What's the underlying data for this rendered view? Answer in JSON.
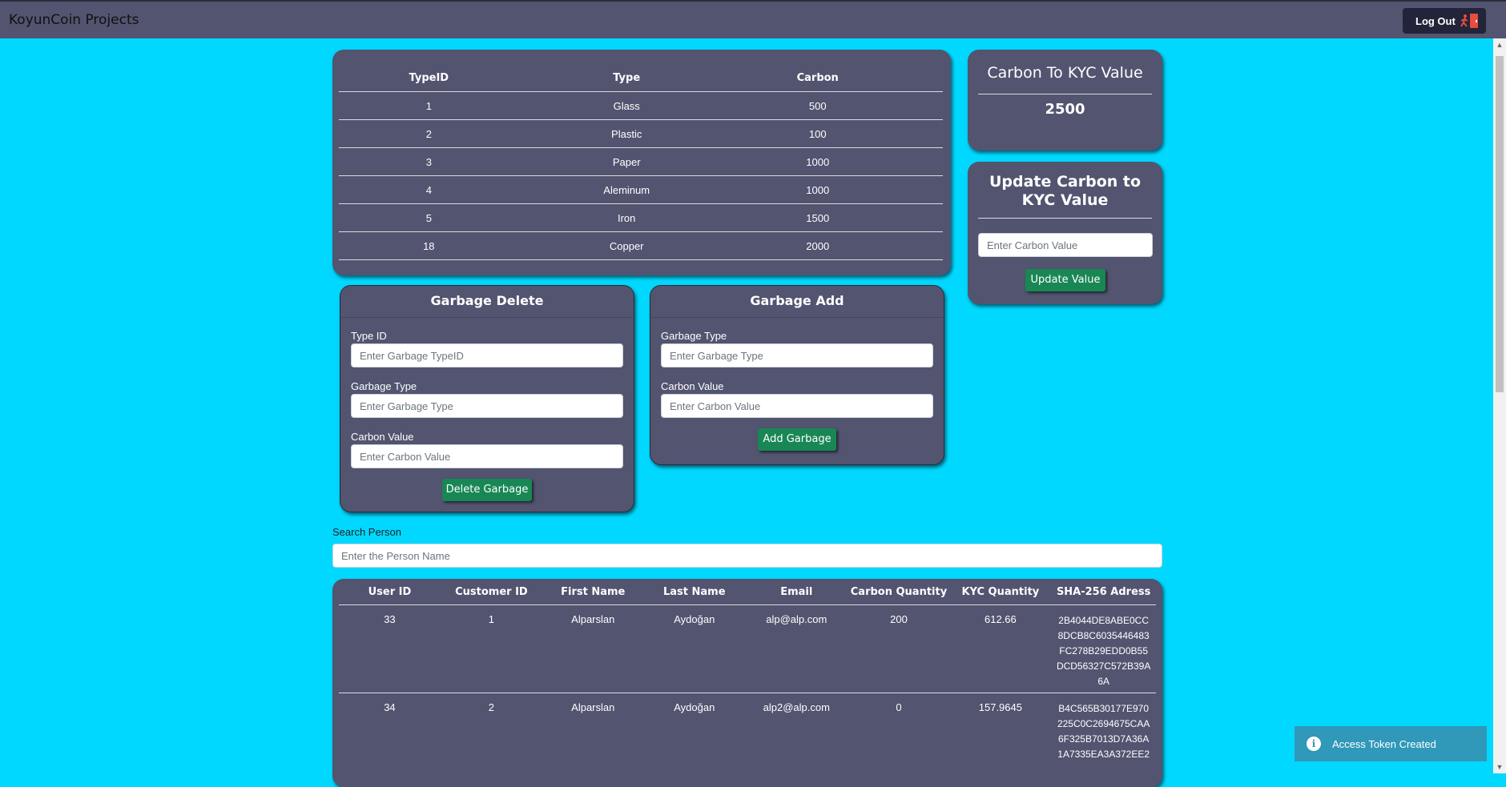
{
  "navbar": {
    "brand": "KoyunCoin Projects",
    "logout_label": "Log Out"
  },
  "garbage_types": {
    "headers": [
      "TypeID",
      "Type",
      "Carbon"
    ],
    "rows": [
      [
        "1",
        "Glass",
        "500"
      ],
      [
        "2",
        "Plastic",
        "100"
      ],
      [
        "3",
        "Paper",
        "1000"
      ],
      [
        "4",
        "Aleminum",
        "1000"
      ],
      [
        "5",
        "Iron",
        "1500"
      ],
      [
        "18",
        "Copper",
        "2000"
      ]
    ]
  },
  "kyc_card": {
    "title": "Carbon To KYC Value",
    "value": "2500"
  },
  "update_card": {
    "title": "Update Carbon to KYC Value",
    "placeholder": "Enter Carbon Value",
    "button": "Update Value"
  },
  "delete_card": {
    "title": "Garbage Delete",
    "type_id_label": "Type ID",
    "type_id_placeholder": "Enter Garbage TypeID",
    "type_label": "Garbage Type",
    "type_placeholder": "Enter Garbage Type",
    "carbon_label": "Carbon Value",
    "carbon_placeholder": "Enter Carbon Value",
    "button": "Delete Garbage"
  },
  "add_card": {
    "title": "Garbage Add",
    "type_label": "Garbage Type",
    "type_placeholder": "Enter Garbage Type",
    "carbon_label": "Carbon Value",
    "carbon_placeholder": "Enter Carbon Value",
    "button": "Add Garbage"
  },
  "search": {
    "label": "Search Person",
    "placeholder": "Enter the Person Name"
  },
  "users": {
    "headers": [
      "User ID",
      "Customer ID",
      "First Name",
      "Last Name",
      "Email",
      "Carbon Quantity",
      "KYC Quantity",
      "SHA-256 Adress"
    ],
    "rows": [
      [
        "33",
        "1",
        "Alparslan",
        "Aydoğan",
        "alp@alp.com",
        "200",
        "612.66",
        "2B4044DE8ABE0CC8DCB8C6035446483FC278B29EDD0B55DCD56327C572B39A6A"
      ],
      [
        "34",
        "2",
        "Alparslan",
        "Aydoğan",
        "alp2@alp.com",
        "0",
        "157.9645",
        "B4C565B30177E970225C0C2694675CAA6F325B7013D7A36A1A7335EA3A372EE2"
      ]
    ]
  },
  "toast": {
    "message": "Access Token Created"
  }
}
